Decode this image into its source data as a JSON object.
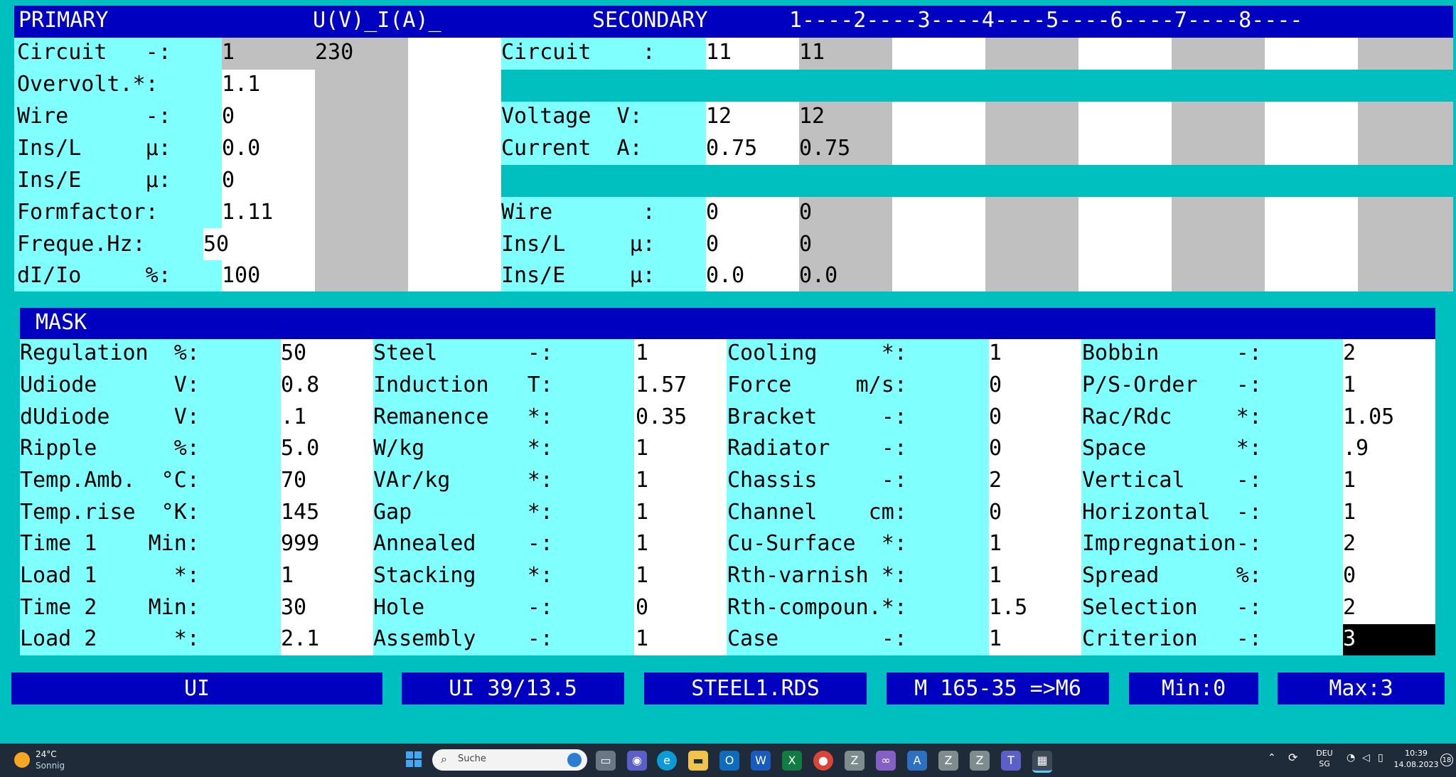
{
  "primary": {
    "title": "PRIMARY",
    "col_header": "U(V)_I(A)_",
    "rows": [
      {
        "label": "Circuit   -:",
        "value": "1",
        "extra": "230"
      },
      {
        "label": "Overvolt.*:",
        "value": "1.1"
      },
      {
        "label": "Wire      -:",
        "value": "0"
      },
      {
        "label": "Ins/L     µ:",
        "value": "0.0"
      },
      {
        "label": "Ins/E     µ:",
        "value": "0"
      },
      {
        "label": "Formfactor:",
        "value": "1.11"
      },
      {
        "label": "Freque.Hz:",
        "value": "50"
      },
      {
        "label": "dI/Io     %:",
        "value": "100"
      }
    ]
  },
  "secondary": {
    "title": "SECONDARY",
    "columns_ruler": "1----2----3----4----5----6----7----8----",
    "rows": [
      {
        "label": "Circuit    :",
        "c1": "11",
        "c2": "11"
      },
      {
        "label": "Voltage  V:",
        "c1": "12",
        "c2": "12"
      },
      {
        "label": "Current  A:",
        "c1": "0.75",
        "c2": "0.75"
      },
      {
        "label": "Wire       :",
        "c1": "0",
        "c2": "0"
      },
      {
        "label": "Ins/L     µ:",
        "c1": "0",
        "c2": "0"
      },
      {
        "label": "Ins/E     µ:",
        "c1": "0.0",
        "c2": "0.0"
      }
    ]
  },
  "mask": {
    "title": "MASK",
    "col1": [
      {
        "label": "Regulation  %:",
        "value": "50"
      },
      {
        "label": "Udiode      V:",
        "value": "0.8"
      },
      {
        "label": "dUdiode     V:",
        "value": ".1"
      },
      {
        "label": "Ripple      %:",
        "value": "5.0"
      },
      {
        "label": "Temp.Amb.  °C:",
        "value": "70"
      },
      {
        "label": "Temp.rise  °K:",
        "value": "145"
      },
      {
        "label": "Time 1    Min:",
        "value": "999"
      },
      {
        "label": "Load 1      *:",
        "value": "1"
      },
      {
        "label": "Time 2    Min:",
        "value": "30"
      },
      {
        "label": "Load 2      *:",
        "value": "2.1"
      }
    ],
    "col2": [
      {
        "label": "Steel       -:",
        "value": "1"
      },
      {
        "label": "Induction   T:",
        "value": "1.57"
      },
      {
        "label": "Remanence   *:",
        "value": "0.35"
      },
      {
        "label": "W/kg        *:",
        "value": "1"
      },
      {
        "label": "VAr/kg      *:",
        "value": "1"
      },
      {
        "label": "Gap         *:",
        "value": "1"
      },
      {
        "label": "Annealed    -:",
        "value": "1"
      },
      {
        "label": "Stacking    *:",
        "value": "1"
      },
      {
        "label": "Hole        -:",
        "value": "0"
      },
      {
        "label": "Assembly    -:",
        "value": "1"
      }
    ],
    "col3": [
      {
        "label": "Cooling     *:",
        "value": "1"
      },
      {
        "label": "Force     m/s:",
        "value": "0"
      },
      {
        "label": "Bracket     -:",
        "value": "0"
      },
      {
        "label": "Radiator    -:",
        "value": "0"
      },
      {
        "label": "Chassis     -:",
        "value": "2"
      },
      {
        "label": "Channel    cm:",
        "value": "0"
      },
      {
        "label": "Cu-Surface  *:",
        "value": "1"
      },
      {
        "label": "Rth-varnish *:",
        "value": "1"
      },
      {
        "label": "Rth-compoun.*:",
        "value": "1.5"
      },
      {
        "label": "Case        -:",
        "value": "1"
      }
    ],
    "col4": [
      {
        "label": "Bobbin      -:",
        "value": "2"
      },
      {
        "label": "P/S-Order   -:",
        "value": "1"
      },
      {
        "label": "Rac/Rdc     *:",
        "value": "1.05"
      },
      {
        "label": "Space       *:",
        "value": ".9"
      },
      {
        "label": "Vertical    -:",
        "value": "1"
      },
      {
        "label": "Horizontal  -:",
        "value": "1"
      },
      {
        "label": "Impregnation-:",
        "value": "2"
      },
      {
        "label": "Spread      %:",
        "value": "0"
      },
      {
        "label": "Selection   -:",
        "value": "2"
      },
      {
        "label": "Criterion   -:",
        "value": "3"
      }
    ]
  },
  "statusbar": {
    "s1": "UI",
    "s2": "UI 39/13.5",
    "s3": "STEEL1.RDS",
    "s4": "M 165-35 =>M6",
    "s5": "Min:0",
    "s6": "Max:3"
  },
  "taskbar": {
    "weather_temp": "24°C",
    "weather_text": "Sonnig",
    "search_placeholder": "Suche",
    "lang_line1": "DEU",
    "lang_line2": "SG",
    "time": "10:39",
    "date": "14.08.2023",
    "notification_count": "18",
    "colors": {
      "bar": "#1f2b38",
      "accent": "#0078d4"
    }
  }
}
